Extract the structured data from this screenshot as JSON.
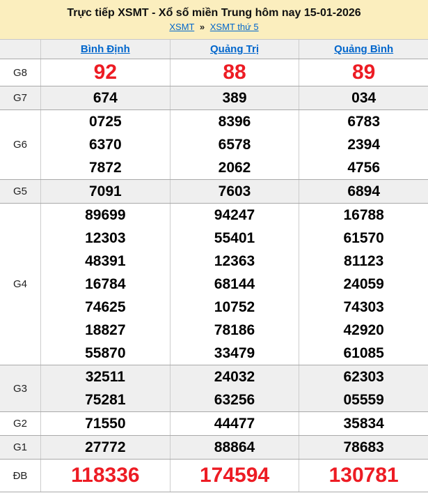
{
  "banner": {
    "title": "Trực tiếp XSMT - Xổ số miền Trung hôm nay 15-01-2026",
    "breadcrumb": {
      "links": [
        "XSMT",
        "XSMT thứ 5"
      ],
      "separator": "»"
    }
  },
  "colors": {
    "banner_background": "#FBEEBE",
    "highlight_red": "#ed1c24",
    "link_blue": "#0066cc",
    "stripe_gray": "#efefef"
  },
  "table": {
    "provinces": [
      "Bình Định",
      "Quảng Trị",
      "Quảng Bình"
    ],
    "rows": [
      {
        "id": "g8",
        "label": "G8",
        "highlight": true,
        "values": [
          [
            "92"
          ],
          [
            "88"
          ],
          [
            "89"
          ]
        ]
      },
      {
        "id": "g7",
        "label": "G7",
        "values": [
          [
            "674"
          ],
          [
            "389"
          ],
          [
            "034"
          ]
        ]
      },
      {
        "id": "g6",
        "label": "G6",
        "values": [
          [
            "0725",
            "6370",
            "7872"
          ],
          [
            "8396",
            "6578",
            "2062"
          ],
          [
            "6783",
            "2394",
            "4756"
          ]
        ]
      },
      {
        "id": "g5",
        "label": "G5",
        "values": [
          [
            "7091"
          ],
          [
            "7603"
          ],
          [
            "6894"
          ]
        ]
      },
      {
        "id": "g4",
        "label": "G4",
        "values": [
          [
            "89699",
            "12303",
            "48391",
            "16784",
            "74625",
            "18827",
            "55870"
          ],
          [
            "94247",
            "55401",
            "12363",
            "68144",
            "10752",
            "78186",
            "33479"
          ],
          [
            "16788",
            "61570",
            "81123",
            "24059",
            "74303",
            "42920",
            "61085"
          ]
        ]
      },
      {
        "id": "g3",
        "label": "G3",
        "values": [
          [
            "32511",
            "75281"
          ],
          [
            "24032",
            "63256"
          ],
          [
            "62303",
            "05559"
          ]
        ]
      },
      {
        "id": "g2",
        "label": "G2",
        "values": [
          [
            "71550"
          ],
          [
            "44477"
          ],
          [
            "35834"
          ]
        ]
      },
      {
        "id": "g1",
        "label": "G1",
        "values": [
          [
            "27772"
          ],
          [
            "88864"
          ],
          [
            "78683"
          ]
        ]
      },
      {
        "id": "db",
        "label": "ĐB",
        "highlight": true,
        "values": [
          [
            "118336"
          ],
          [
            "174594"
          ],
          [
            "130781"
          ]
        ]
      }
    ]
  }
}
